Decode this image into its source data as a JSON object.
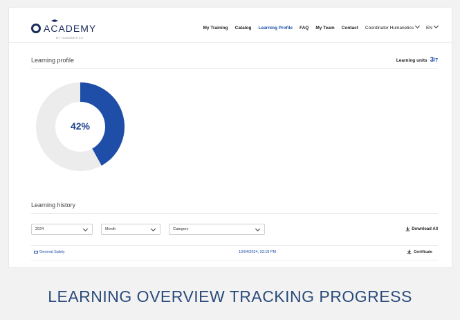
{
  "header": {
    "logo_text": "ACADEMY",
    "logo_sub": "BY HUMANETICS",
    "nav": [
      "My Training",
      "Catalog",
      "Learning Profile",
      "FAQ",
      "My Team",
      "Contact"
    ],
    "active_nav": "Learning Profile",
    "user": "Coordinator Humanetics",
    "lang": "EN"
  },
  "profile": {
    "title": "Learning profile",
    "units_label": "Learning units",
    "units_done": "3",
    "units_total": "/7",
    "percent_text": "42%",
    "percent_value": 0.42
  },
  "history": {
    "title": "Learning history",
    "year": "2024",
    "month": "Month",
    "category": "Category",
    "download_all": "Download All",
    "rows": [
      {
        "course": "General Safety",
        "date": "10/04/2024, 03:18 PM",
        "action": "Certificate"
      }
    ]
  },
  "caption": "LEARNING OVERVIEW TRACKING PROGRESS",
  "colors": {
    "accent": "#1d4fa8",
    "donut_track": "#ececec",
    "donut_fill": "#1f4ea8"
  }
}
